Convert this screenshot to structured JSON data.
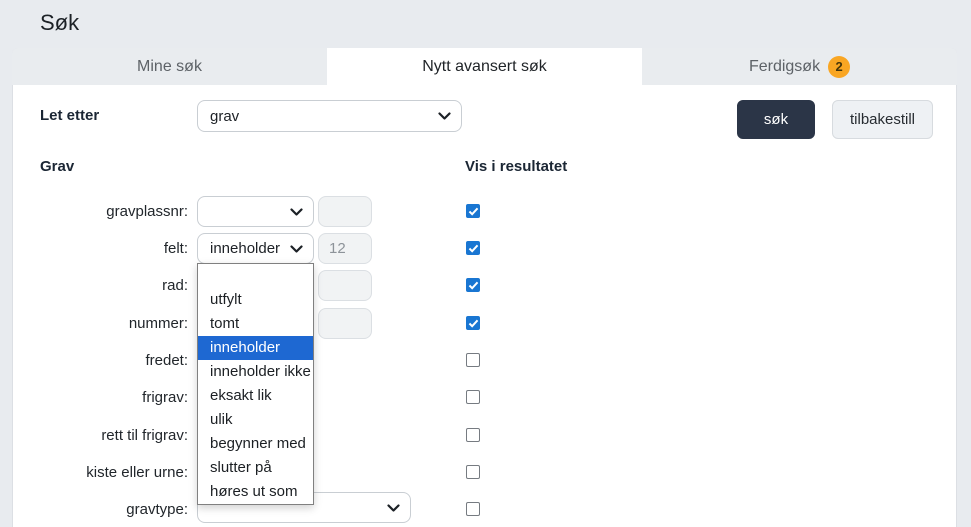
{
  "page": {
    "title": "Søk"
  },
  "tabs": [
    {
      "label": "Mine søk",
      "active": "false"
    },
    {
      "label": "Nytt avansert søk",
      "active": "true"
    },
    {
      "label": "Ferdigsøk",
      "active": "false",
      "badge": "2"
    }
  ],
  "toolbar": {
    "search_label": "søk",
    "reset_label": "tilbakestill"
  },
  "search_for": {
    "label": "Let etter",
    "value": "grav"
  },
  "section": {
    "title": "Grav",
    "results_header": "Vis i resultatet"
  },
  "form": {
    "rows": [
      {
        "label": "gravplassnr:",
        "select_value": "",
        "input_value": "",
        "checked": "true"
      },
      {
        "label": "felt:",
        "select_value": "inneholder",
        "input_value": "12",
        "checked": "true"
      },
      {
        "label": "rad:",
        "input_value": "",
        "checked": "true"
      },
      {
        "label": "nummer:",
        "input_value": "",
        "checked": "true"
      },
      {
        "label": "fredet:",
        "checked": "false"
      },
      {
        "label": "frigrav:",
        "checked": "false"
      },
      {
        "label": "rett til frigrav:",
        "checked": "false"
      },
      {
        "label": "kiste eller urne:",
        "checked": "false"
      },
      {
        "label": "gravtype:",
        "select_value": "",
        "checked": "false"
      }
    ]
  },
  "dropdown": {
    "options": [
      {
        "label": "",
        "selected": "false"
      },
      {
        "label": "utfylt",
        "selected": "false"
      },
      {
        "label": "tomt",
        "selected": "false"
      },
      {
        "label": "inneholder",
        "selected": "true"
      },
      {
        "label": "inneholder ikke",
        "selected": "false"
      },
      {
        "label": "eksakt lik",
        "selected": "false"
      },
      {
        "label": "ulik",
        "selected": "false"
      },
      {
        "label": "begynner med",
        "selected": "false"
      },
      {
        "label": "slutter på",
        "selected": "false"
      },
      {
        "label": "høres ut som",
        "selected": "false"
      }
    ]
  },
  "colors": {
    "checkbox_blue": "#1976d2",
    "selected_option_bg": "#1e68d2",
    "badge_orange": "#f9a623",
    "dark_button_bg": "#2b3547"
  }
}
